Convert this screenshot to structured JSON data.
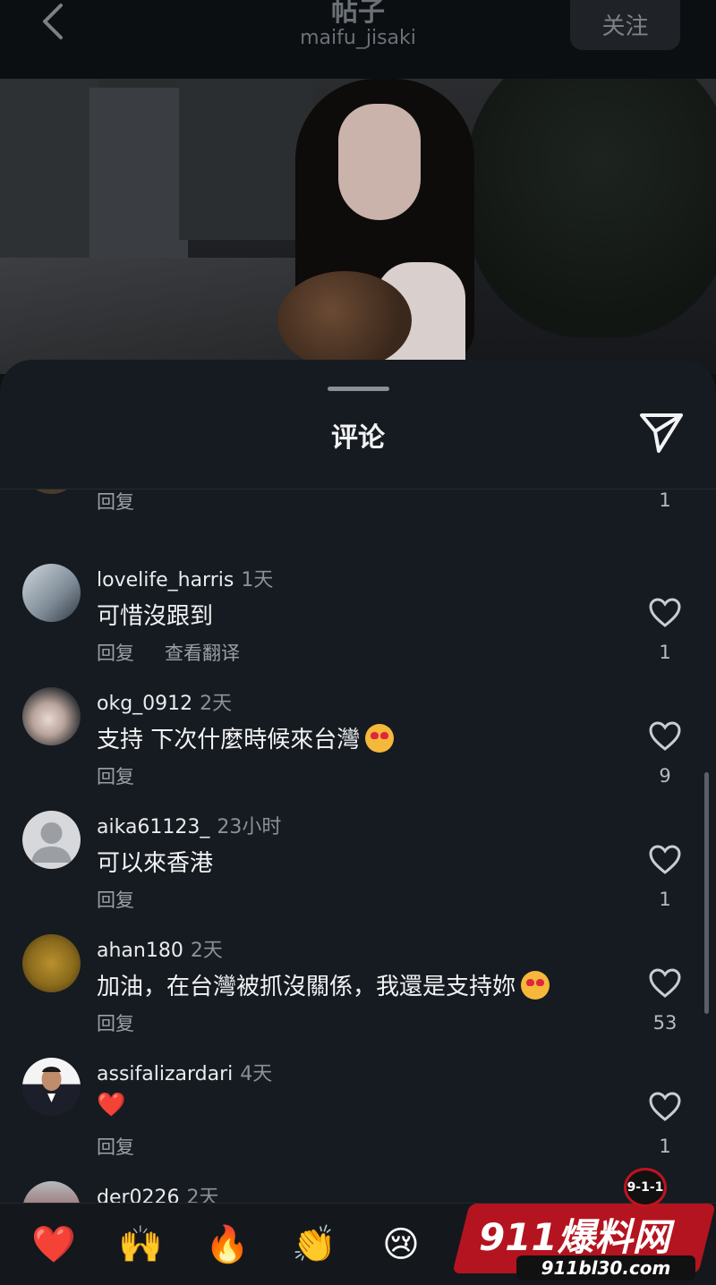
{
  "header": {
    "title": "帖子",
    "subtitle": "maifu_jisaki",
    "follow_label": "关注"
  },
  "sheet": {
    "title": "评论"
  },
  "partial_comment": {
    "reply_label": "回复",
    "likes": "1"
  },
  "comments": [
    {
      "username": "lovelife_harris",
      "time": "1天",
      "text": "可惜沒跟到",
      "reply_label": "回复",
      "translate_label": "查看翻译",
      "likes": "1"
    },
    {
      "username": "okg_0912",
      "time": "2天",
      "text": "支持 下次什麼時候來台灣",
      "reply_label": "回复",
      "likes": "9"
    },
    {
      "username": "aika61123_",
      "time": "23小时",
      "text": "可以來香港",
      "reply_label": "回复",
      "likes": "1"
    },
    {
      "username": "ahan180",
      "time": "2天",
      "text": "加油，在台灣被抓沒關係，我還是支持妳",
      "reply_label": "回复",
      "likes": "53"
    },
    {
      "username": "assifalizardari",
      "time": "4天",
      "text": "❤️",
      "reply_label": "回复",
      "likes": "1"
    },
    {
      "username": "der0226",
      "time": "2天"
    }
  ],
  "reactions": [
    "❤️",
    "🙌",
    "🔥",
    "👏",
    "😢"
  ],
  "watermark": {
    "badge": "9-1-1",
    "main": "911爆料网",
    "url": "911bl30.com"
  },
  "colors": {
    "background": "#0e1114",
    "sheet": "#161b21",
    "heart_red": "#e0263f",
    "watermark_red": "#b41420"
  }
}
